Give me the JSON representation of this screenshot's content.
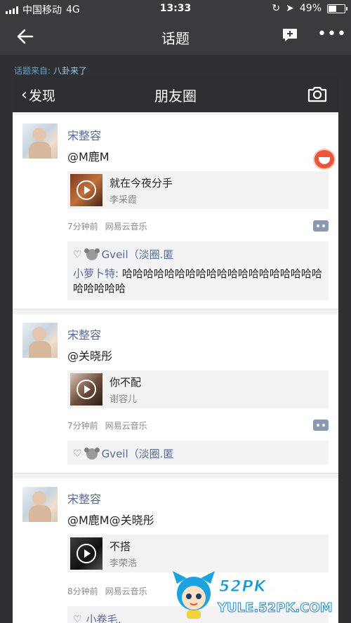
{
  "status_bar": {
    "carrier": "中国移动",
    "network": "4G",
    "time": "13:33",
    "battery_percent": "49%",
    "battery_level": 0.49
  },
  "nav": {
    "title": "话题",
    "back_icon": "arrow-left-icon",
    "edit_icon": "chat-plus-icon",
    "more_icon": "more-dots-icon"
  },
  "source": {
    "prefix": "话题来自:",
    "topic": "八卦来了"
  },
  "embedded": {
    "back_label": "发现",
    "title": "朋友圈",
    "camera_icon": "camera-icon",
    "posts": [
      {
        "author": "宋整容",
        "text": "@M鹿M",
        "song": "就在今夜分手",
        "singer": "李采霞",
        "time": "7分钟前",
        "app": "网易云音乐",
        "likes": "Gveil（淡圈.匿",
        "comment_author": "小萝卜特:",
        "comment_text": "哈哈哈哈哈哈哈哈哈哈哈哈哈哈哈哈哈哈哈哈哈哈哈哈"
      },
      {
        "author": "宋整容",
        "text": "@关晓彤",
        "song": "你不配",
        "singer": "谢容儿",
        "time": "7分钟前",
        "app": "网易云音乐",
        "likes": "Gveil（淡圈.匿"
      },
      {
        "author": "宋整容",
        "text": "@M鹿M@关晓彤",
        "song": "不搭",
        "singer": "李荣浩",
        "time": "8分钟前",
        "app": "网易云音乐",
        "likes": "小卷毛,"
      }
    ]
  },
  "watermark": {
    "title": "52PK娱乐频道",
    "url": "YULE.52PK.COM"
  },
  "colors": {
    "link": "#586b95",
    "header": "#3a3b3e",
    "wechat_bar": "#2e2f32"
  }
}
